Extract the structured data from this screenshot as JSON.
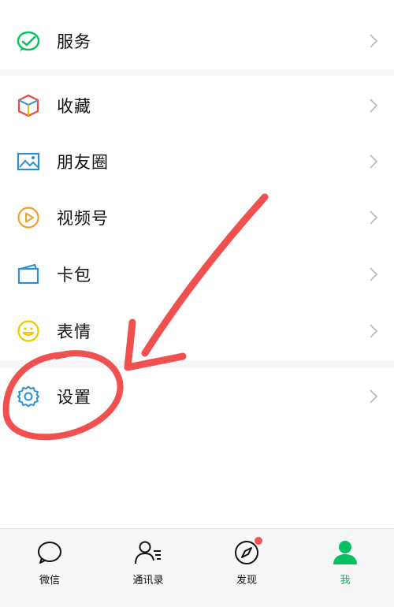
{
  "menu": {
    "items": [
      {
        "label": "服务",
        "icon": "wechat-pay-check-icon"
      },
      {
        "label": "收藏",
        "icon": "cube-icon"
      },
      {
        "label": "朋友圈",
        "icon": "image-icon"
      },
      {
        "label": "视频号",
        "icon": "play-circle-icon"
      },
      {
        "label": "卡包",
        "icon": "wallet-icon"
      },
      {
        "label": "表情",
        "icon": "smiley-icon"
      },
      {
        "label": "设置",
        "icon": "gear-icon"
      }
    ]
  },
  "tabbar": {
    "tabs": [
      {
        "label": "微信",
        "icon": "chat-bubble-icon",
        "active": false
      },
      {
        "label": "通讯录",
        "icon": "contacts-icon",
        "active": false
      },
      {
        "label": "发现",
        "icon": "compass-icon",
        "active": false,
        "badge": "red-dot"
      },
      {
        "label": "我",
        "icon": "person-icon",
        "active": true
      }
    ]
  },
  "annotation": {
    "type": "red-arrow-and-circle",
    "color": "#f05050",
    "target": "设置"
  },
  "colors": {
    "accent": "#07c160",
    "arrow": "#f05050",
    "settings_icon": "#2a8fd6"
  }
}
